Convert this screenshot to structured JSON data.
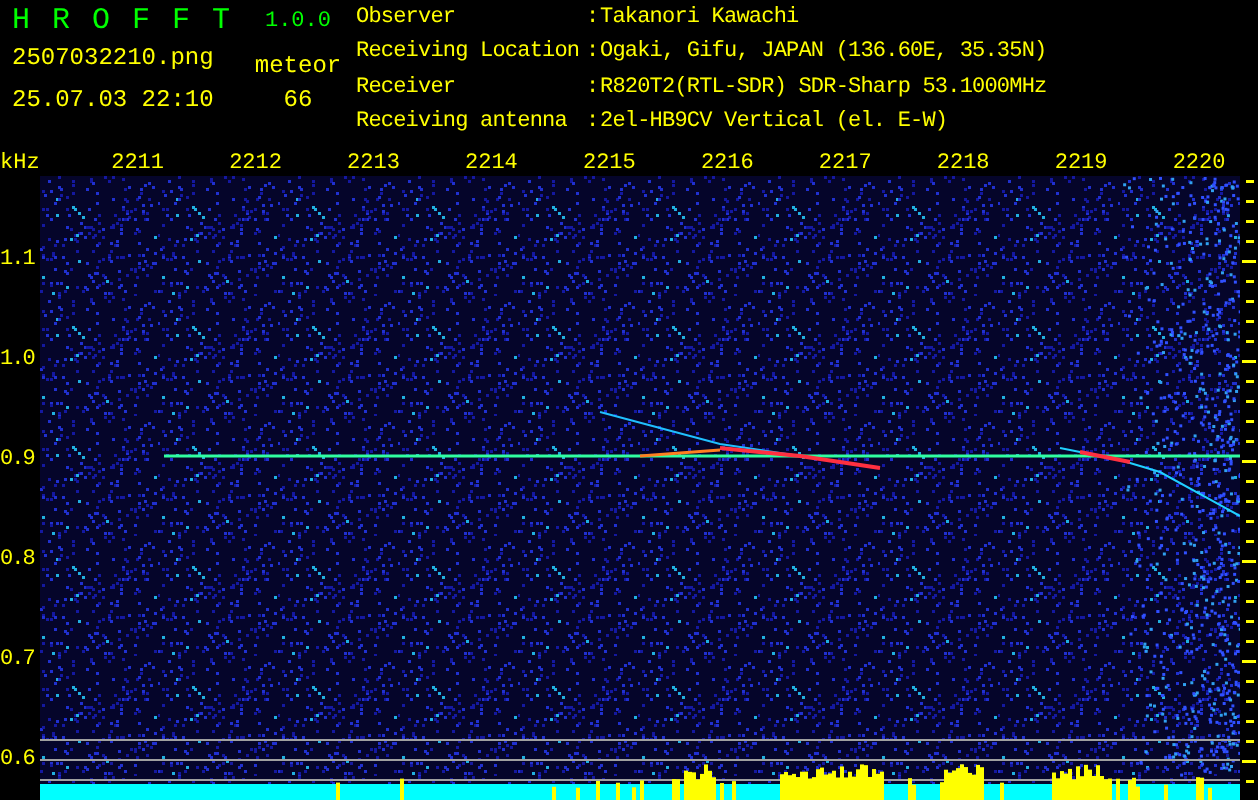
{
  "header": {
    "app_title": "H R O F F T",
    "version": "1.0.0",
    "filename": "2507032210.png",
    "datetime": "25.07.03 22:10",
    "meteor_label": "meteor",
    "meteor_count": "66",
    "info": [
      {
        "label": "Observer",
        "separator": ":",
        "value": "Takanori Kawachi"
      },
      {
        "label": "Receiving Location",
        "separator": ":",
        "value": "Ogaki, Gifu, JAPAN (136.60E, 35.35N)"
      },
      {
        "label": "Receiver",
        "separator": ":",
        "value": "R820T2(RTL-SDR) SDR-Sharp 53.1000MHz"
      },
      {
        "label": "Receiving antenna",
        "separator": ":",
        "value": "2el-HB9CV Vertical (el. E-W)"
      }
    ]
  },
  "plot": {
    "y_unit": "kHz",
    "y_labels": [
      "1.1",
      "1.0",
      "0.9",
      "0.8",
      "0.7",
      "0.6"
    ],
    "x_labels": [
      "2211",
      "2212",
      "2213",
      "2214",
      "2215",
      "2216",
      "2217",
      "2218",
      "2219",
      "2220"
    ]
  }
}
